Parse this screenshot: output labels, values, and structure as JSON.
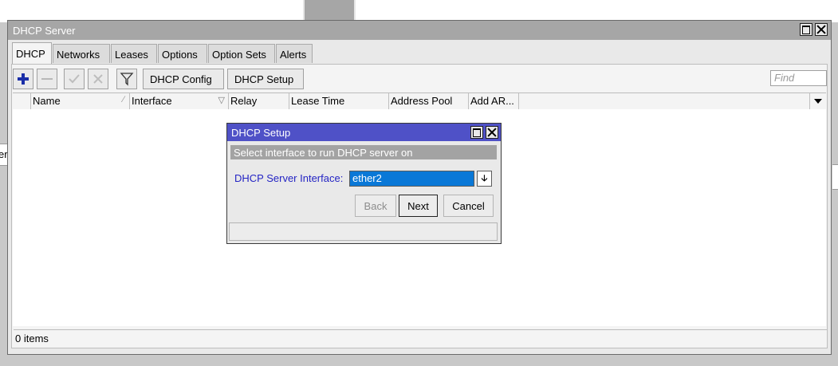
{
  "background": {
    "left_fragment": "er"
  },
  "window": {
    "title": "DHCP Server",
    "tabs": [
      "DHCP",
      "Networks",
      "Leases",
      "Options",
      "Option Sets",
      "Alerts"
    ],
    "toolbar": {
      "config_label": "DHCP Config",
      "setup_label": "DHCP Setup",
      "find_placeholder": "Find"
    },
    "columns": [
      "Name",
      "Interface",
      "Relay",
      "Lease Time",
      "Address Pool",
      "Add AR..."
    ],
    "status": "0 items"
  },
  "dialog": {
    "title": "DHCP Setup",
    "subtitle": "Select interface to run DHCP server on",
    "field_label": "DHCP Server Interface:",
    "field_value": "ether2",
    "back_label": "Back",
    "next_label": "Next",
    "cancel_label": "Cancel"
  },
  "colors": {
    "dialog_title": "#4f51c7",
    "selection": "#0a78d7",
    "field_label": "#2424c4",
    "add_icon": "#1a2ea8"
  }
}
